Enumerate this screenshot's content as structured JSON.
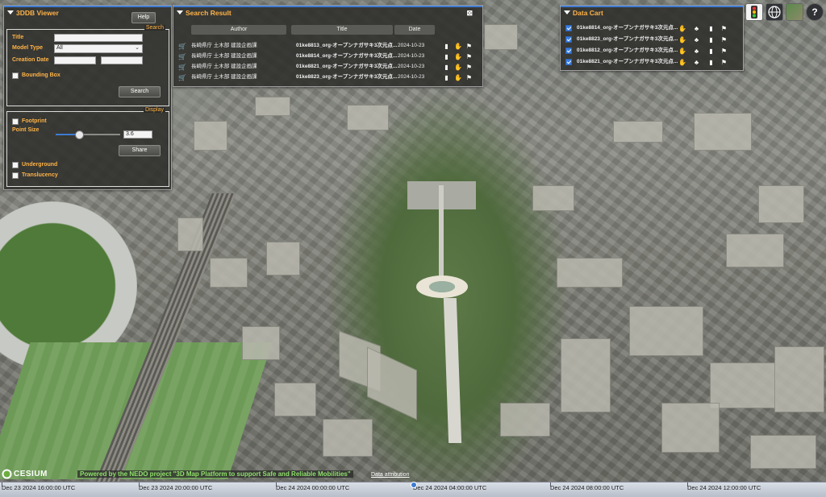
{
  "viewer_panel": {
    "title": "3DDB Viewer",
    "help_label": "Help",
    "search_legend": "Search",
    "title_label": "Title",
    "title_value": "",
    "model_type_label": "Model Type",
    "model_type_value": "All",
    "creation_date_label": "Creation Date",
    "creation_date_from": "",
    "creation_date_to": "",
    "bounding_box_label": "Bounding Box",
    "search_button": "Search",
    "display_legend": "Display",
    "footprint_label": "Footprint",
    "point_size_label": "Point Size",
    "point_size_value": "3.6",
    "point_size_fraction": 0.36,
    "share_button": "Share",
    "underground_label": "Underground",
    "translucency_label": "Translucency"
  },
  "search_result": {
    "title": "Search Result",
    "columns": [
      "Author",
      "Title",
      "Date"
    ],
    "rows": [
      {
        "author": "長崎県庁 土木部 建設企画課",
        "title": "01ke8813_org-オープンナガサキ3次元点...",
        "date": "2024-10-23"
      },
      {
        "author": "長崎県庁 土木部 建設企画課",
        "title": "01ke8814_org-オープンナガサキ3次元点...",
        "date": "2024-10-23"
      },
      {
        "author": "長崎県庁 土木部 建設企画課",
        "title": "01ke8821_org-オープンナガサキ3次元点...",
        "date": "2024-10-23"
      },
      {
        "author": "長崎県庁 土木部 建設企画課",
        "title": "01ke8823_org-オープンナガサキ3次元点...",
        "date": "2024-10-23"
      }
    ]
  },
  "data_cart": {
    "title": "Data Cart",
    "items": [
      {
        "label": "01ke8814_org-オープンナガサキ3次元点...",
        "checked": true
      },
      {
        "label": "01ke8823_org-オープンナガサキ3次元点...",
        "checked": true
      },
      {
        "label": "01ke8812_org-オープンナガサキ3次元点...",
        "checked": true
      },
      {
        "label": "01ke8821_org-オープンナガサキ3次元点...",
        "checked": true
      }
    ]
  },
  "top_buttons": {
    "help_glyph": "?"
  },
  "credits": {
    "logo_text": "CESIUM",
    "nedo_text": "Powered by the NEDO project \"3D Map Platform to support Safe and Reliable Mobilities\"",
    "attribution_link": "Data attribution"
  },
  "timeline": {
    "labels": [
      "Dec 23 2024 16:00:00 UTC",
      "Dec 23 2024 20:00:00 UTC",
      "Dec 24 2024 00:00:00 UTC",
      "Dec 24 2024 04:00:00 UTC",
      "Dec 24 2024 08:00:00 UTC",
      "Dec 24 2024 12:00:00 UTC"
    ]
  },
  "colors": {
    "accent_orange": "#ffb347",
    "accent_blue": "#3e7bd1",
    "credit_green": "#8fe06a"
  },
  "icons": [
    "chart-icon",
    "hand-icon",
    "tree-icon",
    "marker-icon",
    "cart-icon",
    "traffic-light-icon",
    "globe-icon",
    "map-layer-icon",
    "help-icon"
  ]
}
